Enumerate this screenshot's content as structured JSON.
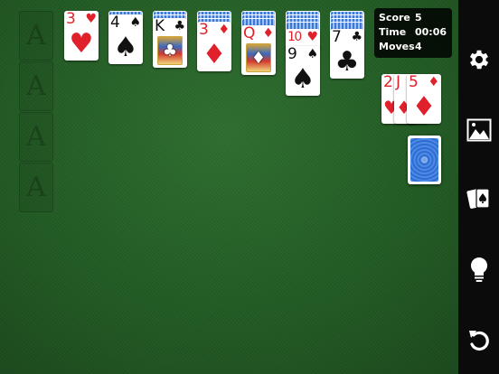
{
  "stats": {
    "score_label": "Score",
    "score_value": "5",
    "time_label": "Time",
    "time_value": "00:06",
    "moves_label": "Moves",
    "moves_value": "4"
  },
  "foundations": [
    {
      "placeholder": "A"
    },
    {
      "placeholder": "A"
    },
    {
      "placeholder": "A"
    },
    {
      "placeholder": "A"
    }
  ],
  "tableau": [
    {
      "rank": "3",
      "suit": "♥",
      "color": "red"
    },
    {
      "rank": "4",
      "suit": "♠",
      "color": "black"
    },
    {
      "rank": "K",
      "suit": "♣",
      "color": "black"
    },
    {
      "rank": "3",
      "suit": "♦",
      "color": "red"
    },
    {
      "rank": "Q",
      "suit": "♦",
      "color": "red"
    },
    {
      "rank": "10",
      "suit": "♥",
      "color": "red"
    },
    {
      "rank": "9",
      "suit": "♠",
      "color": "black"
    },
    {
      "rank": "7",
      "suit": "♣",
      "color": "black"
    }
  ],
  "waste": [
    {
      "rank": "2",
      "suit": "♥",
      "color": "red"
    },
    {
      "rank": "J",
      "suit": "♦",
      "color": "red"
    },
    {
      "rank": "5",
      "suit": "♦",
      "color": "red"
    }
  ],
  "sidebar": {
    "icons": [
      "gear-icon",
      "landscape-icon",
      "cards-icon",
      "lightbulb-icon",
      "undo-icon"
    ]
  },
  "colors": {
    "red": "#e0202a",
    "black": "#111111",
    "felt": "#2a642b"
  }
}
